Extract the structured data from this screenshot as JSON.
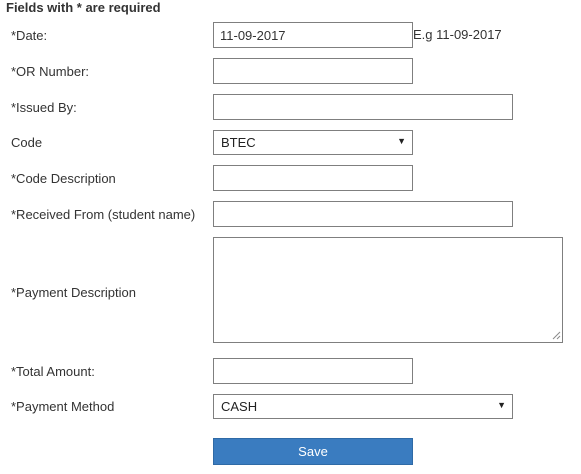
{
  "form": {
    "required_note": "Fields with * are required",
    "date": {
      "label": "*Date:",
      "value": "11-09-2017",
      "example": "E.g 11-09-2017"
    },
    "or_number": {
      "label": "*OR Number:",
      "value": ""
    },
    "issued_by": {
      "label": "*Issued By:",
      "value": ""
    },
    "code": {
      "label": "Code",
      "selected": "BTEC",
      "icon": "chevron-down-icon"
    },
    "code_description": {
      "label": "*Code Description",
      "value": ""
    },
    "received_from": {
      "label": "*Received From (student name)",
      "value": ""
    },
    "payment_description": {
      "label": "*Payment Description",
      "value": ""
    },
    "total_amount": {
      "label": "*Total Amount:",
      "value": ""
    },
    "payment_method": {
      "label": "*Payment Method",
      "selected": "CASH",
      "icon": "chevron-down-icon"
    },
    "save_label": "Save"
  },
  "colors": {
    "text": "#333333",
    "border": "#7f7f7f",
    "button_bg": "#3a7cc0",
    "button_text": "#ffffff"
  }
}
